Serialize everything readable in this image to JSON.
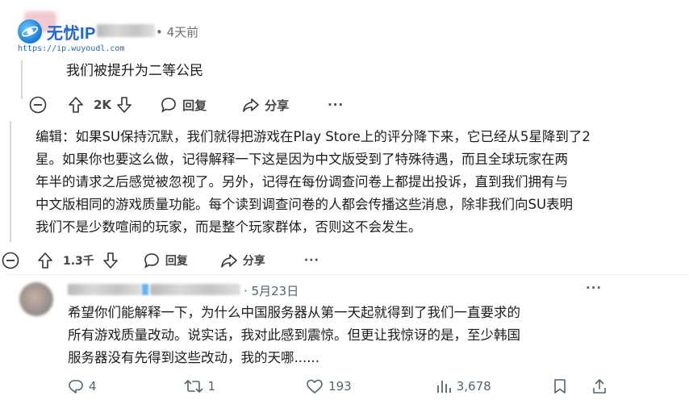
{
  "watermark": {
    "brand": "无忧IP",
    "url": "https://ip.wuyoudl.com"
  },
  "comment1": {
    "time": "4天前",
    "body": "我们被提升为二等公民",
    "votes": "2K",
    "reply_label": "回复",
    "share_label": "分享",
    "more": "···"
  },
  "comment2": {
    "body_lines": [
      "编辑：如果SU保持沉默，我们就得把游戏在Play Store上的评分降下来，它已经从5星降到了2",
      "星。如果你也要这么做，记得解释一下这是因为中文版受到了特殊待遇，而且全球玩家在两",
      "年半的请求之后感觉被忽视了。另外，记得在每份调查问卷上都提出投诉，直到我们拥有与",
      "中文版相同的游戏质量功能。每个读到调查问卷的人都会传播这些消息，除非我们向SU表明",
      "我们不是少数喧闹的玩家，而是整个玩家群体，否则这不会发生。"
    ],
    "votes": "1.3千",
    "reply_label": "回复",
    "share_label": "分享",
    "more": "···"
  },
  "tweet": {
    "date": "5月23日",
    "more": "···",
    "body_lines": [
      "希望你们能解释一下，为什么中国服务器从第一天起就得到了我们一直要求的",
      "所有游戏质量改动。说实话，我对此感到震惊。但更让我惊讶的是，至少韩国",
      "服务器没有先得到这些改动，我的天哪......"
    ],
    "replies": "4",
    "retweets": "1",
    "likes": "193",
    "views": "3,678"
  }
}
